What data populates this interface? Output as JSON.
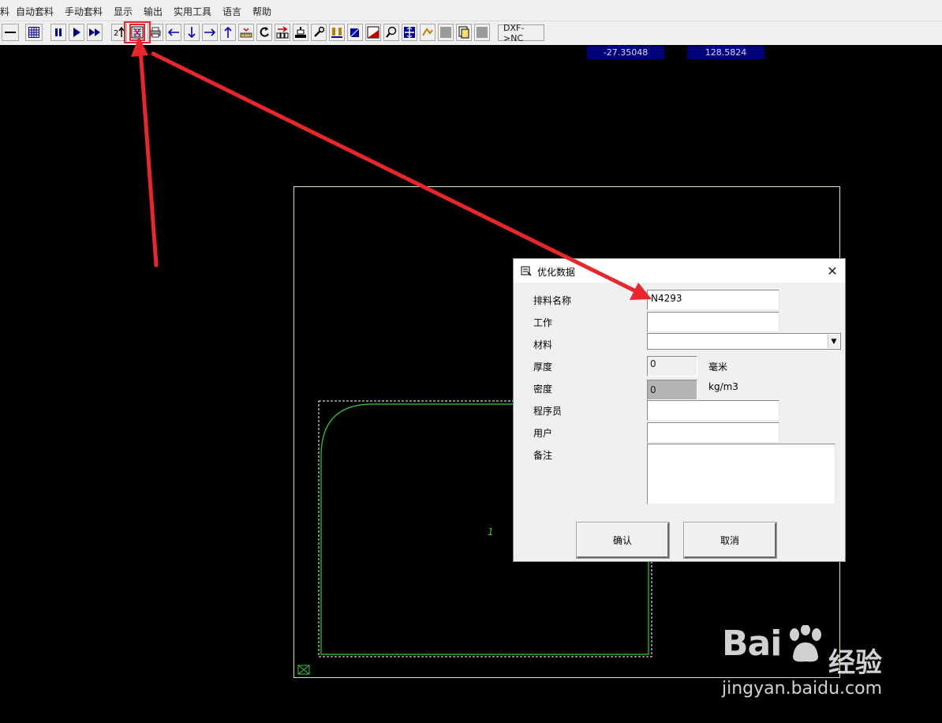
{
  "menu": {
    "items": [
      {
        "label": "料"
      },
      {
        "label": "自动套料"
      },
      {
        "label": "手动套料"
      },
      {
        "label": "显示"
      },
      {
        "label": "输出"
      },
      {
        "label": "实用工具"
      },
      {
        "label": "语言"
      },
      {
        "label": "帮助"
      }
    ]
  },
  "toolbar": {
    "dxf_nc_label": "DXF->NC"
  },
  "status": {
    "coord_x": "-27.35048",
    "coord_y": "128.5824"
  },
  "canvas": {
    "part_number": "1"
  },
  "dialog": {
    "title": "优化数据",
    "close_symbol": "✕",
    "fields": {
      "nest_name_label": "排料名称",
      "nest_name_value": "N4293",
      "job_label": "工作",
      "job_value": "",
      "material_label": "材料",
      "material_value": "",
      "thickness_label": "厚度",
      "thickness_value": "0",
      "thickness_unit": "毫米",
      "density_label": "密度",
      "density_value": "0",
      "density_unit": "kg/m3",
      "programmer_label": "程序员",
      "programmer_value": "",
      "customer_label": "用户",
      "customer_value": "",
      "remarks_label": "备注",
      "remarks_value": ""
    },
    "ok_label": "确认",
    "cancel_label": "取消"
  },
  "watermark": {
    "brand": "Bai",
    "brand_cn": "经验",
    "url": "jingyan.baidu.com"
  },
  "colors": {
    "canvas_bg": "#000000",
    "part_outline": "#33cc33",
    "annotation_arrow": "#e8262b",
    "coord_bg": "#00007a"
  }
}
